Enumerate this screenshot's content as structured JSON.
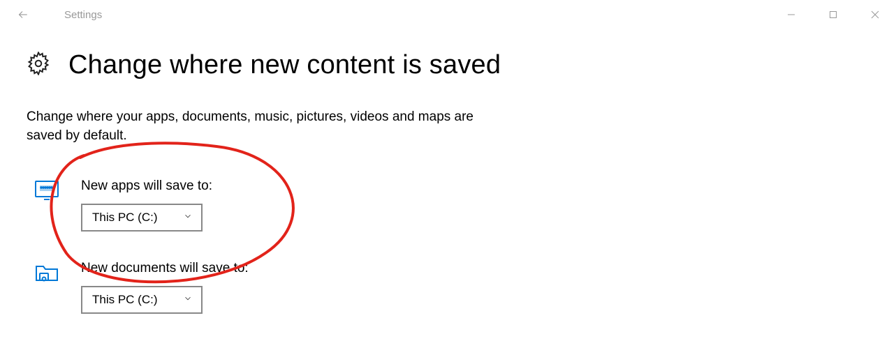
{
  "window": {
    "title": "Settings"
  },
  "page": {
    "heading": "Change where new content is saved",
    "description": "Change where your apps, documents, music, pictures, videos and maps are saved by default."
  },
  "settings": {
    "apps": {
      "label": "New apps will save to:",
      "value": "This PC (C:)"
    },
    "documents": {
      "label": "New documents will save to:",
      "value": "This PC (C:)"
    }
  },
  "colors": {
    "accent": "#0078D7"
  }
}
